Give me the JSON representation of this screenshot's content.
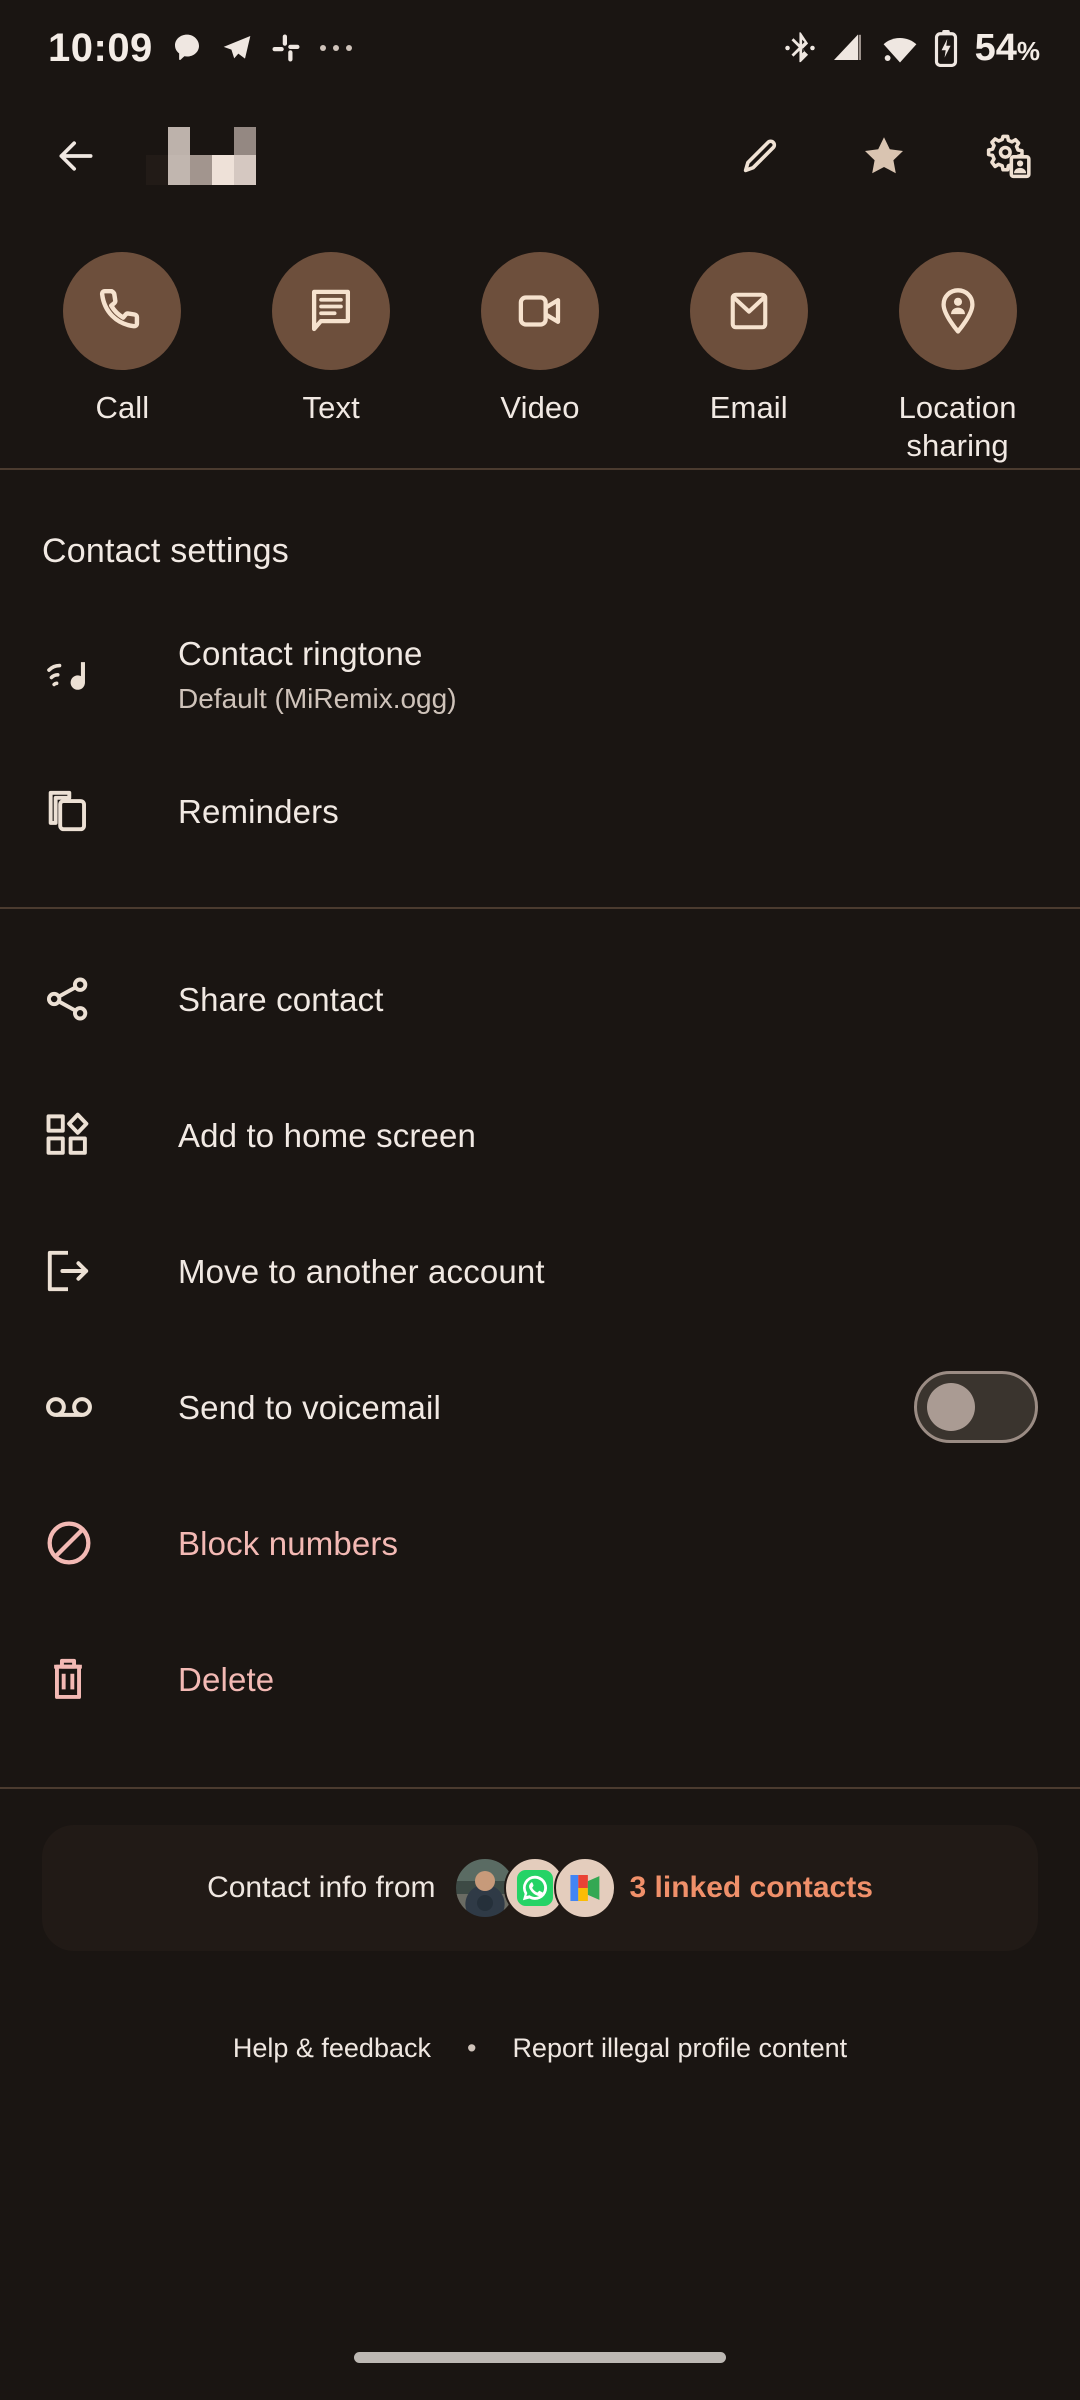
{
  "status_bar": {
    "time": "10:09",
    "notification_icons": [
      "chat-bubble-icon",
      "telegram-icon",
      "slack-icon",
      "more-notifications-icon"
    ],
    "system_icons": [
      "bluetooth-icon",
      "cellular-signal-icon",
      "wifi-icon",
      "battery-charging-icon"
    ],
    "battery_percent": "54",
    "battery_unit": "%"
  },
  "app_bar": {
    "back_icon": "back-arrow-icon",
    "contact_name_redacted": true,
    "actions": [
      {
        "name": "edit-contact-button",
        "icon": "pencil-icon"
      },
      {
        "name": "favorite-button",
        "icon": "star-icon"
      },
      {
        "name": "contact-settings-button",
        "icon": "manage-accounts-icon"
      }
    ]
  },
  "quick_actions": [
    {
      "label": "Call",
      "icon": "phone-icon"
    },
    {
      "label": "Text",
      "icon": "message-icon"
    },
    {
      "label": "Video",
      "icon": "video-camera-icon"
    },
    {
      "label": "Email",
      "icon": "mail-icon"
    },
    {
      "label": "Location sharing",
      "icon": "location-pin-icon"
    }
  ],
  "contact_settings": {
    "title": "Contact settings",
    "ringtone": {
      "title": "Contact ringtone",
      "subtitle": "Default (MiRemix.ogg)",
      "icon": "ringtone-icon"
    },
    "reminders": {
      "title": "Reminders",
      "icon": "reminders-icon"
    }
  },
  "actions_list": [
    {
      "title": "Share contact",
      "icon": "share-icon"
    },
    {
      "title": "Add to home screen",
      "icon": "widgets-icon"
    },
    {
      "title": "Move to another account",
      "icon": "move-out-icon"
    },
    {
      "title": "Send to voicemail",
      "icon": "voicemail-icon",
      "toggle": "off"
    },
    {
      "title": "Block numbers",
      "icon": "block-icon",
      "destructive": true
    },
    {
      "title": "Delete",
      "icon": "trash-icon",
      "destructive": true
    }
  ],
  "linked_contacts": {
    "label": "Contact info from",
    "count_label": "3 linked contacts",
    "sources": [
      "profile-photo-avatar",
      "whatsapp-avatar",
      "google-contacts-avatar"
    ]
  },
  "footer": {
    "help": "Help & feedback",
    "separator": "•",
    "report": "Report illegal profile content"
  },
  "colors": {
    "background": "#1a1512",
    "accent_circle": "#6d4f3c",
    "icon_tint": "#f4ddc9",
    "text_primary": "#f1e9e3",
    "text_secondary": "#cfc3ba",
    "destructive": "#f3b9b4",
    "link_orange": "#f0906a",
    "divider": "#4b3b2f"
  }
}
